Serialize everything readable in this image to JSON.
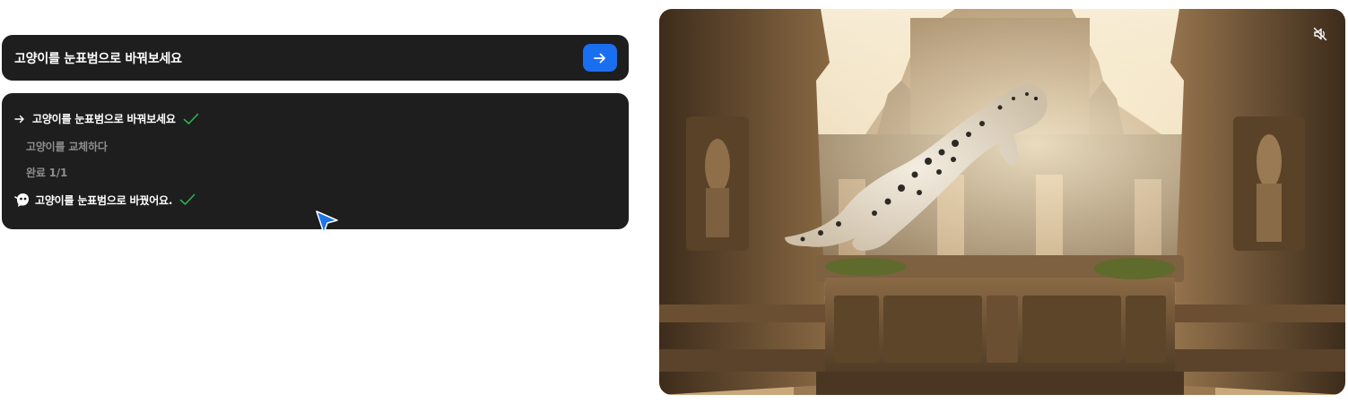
{
  "prompt": {
    "text": "고양이를 눈표범으로 바꿔보세요",
    "send_icon": "arrow-right-icon",
    "send_color": "#1a6ef0"
  },
  "log": {
    "request": "고양이를 눈표범으로 바꿔보세요",
    "step": "고양이를 교체하다",
    "progress": "완료 1/1",
    "result": "고양이를 눈표범으로 바꿨어요.",
    "check_color": "#2bb24c"
  },
  "video": {
    "mute_icon": "speaker-muted-icon"
  }
}
